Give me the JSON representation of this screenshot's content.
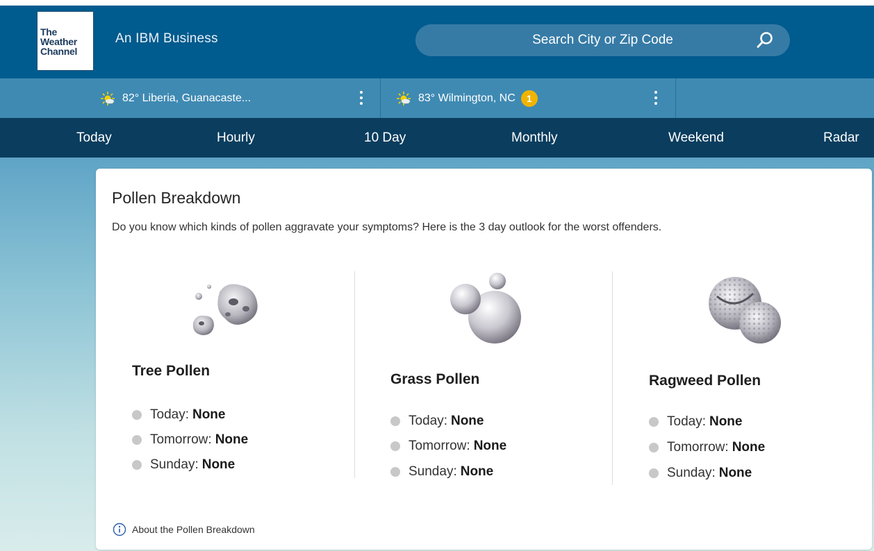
{
  "header": {
    "logo_line1": "The",
    "logo_line2": "Weather",
    "logo_line3": "Channel",
    "tagline": "An IBM Business",
    "search_placeholder": "Search City or Zip Code"
  },
  "locations": [
    {
      "temp_place": "82° Liberia, Guanacaste...",
      "icon": "sun-cloud-icon"
    },
    {
      "temp_place": "83° Wilmington, NC",
      "icon": "sun-cloud-icon",
      "alert_count": "1"
    }
  ],
  "nav": [
    "Today",
    "Hourly",
    "10 Day",
    "Monthly",
    "Weekend",
    "Radar"
  ],
  "card": {
    "title": "Pollen Breakdown",
    "description": "Do you know which kinds of pollen aggravate your symptoms? Here is the 3 day outlook for the worst offenders.",
    "about_link": "About the Pollen Breakdown",
    "columns": [
      {
        "title": "Tree Pollen",
        "rows": [
          {
            "day": "Today:",
            "level": "None"
          },
          {
            "day": "Tomorrow:",
            "level": "None"
          },
          {
            "day": "Sunday:",
            "level": "None"
          }
        ]
      },
      {
        "title": "Grass Pollen",
        "rows": [
          {
            "day": "Today:",
            "level": "None"
          },
          {
            "day": "Tomorrow:",
            "level": "None"
          },
          {
            "day": "Sunday:",
            "level": "None"
          }
        ]
      },
      {
        "title": "Ragweed Pollen",
        "rows": [
          {
            "day": "Today:",
            "level": "None"
          },
          {
            "day": "Tomorrow:",
            "level": "None"
          },
          {
            "day": "Sunday:",
            "level": "None"
          }
        ]
      }
    ]
  },
  "colors": {
    "header_bg": "#005b8e",
    "location_bar_bg": "#3f8ab3",
    "nav_bg": "#0a3d5e",
    "alert_badge": "#f0b400"
  }
}
